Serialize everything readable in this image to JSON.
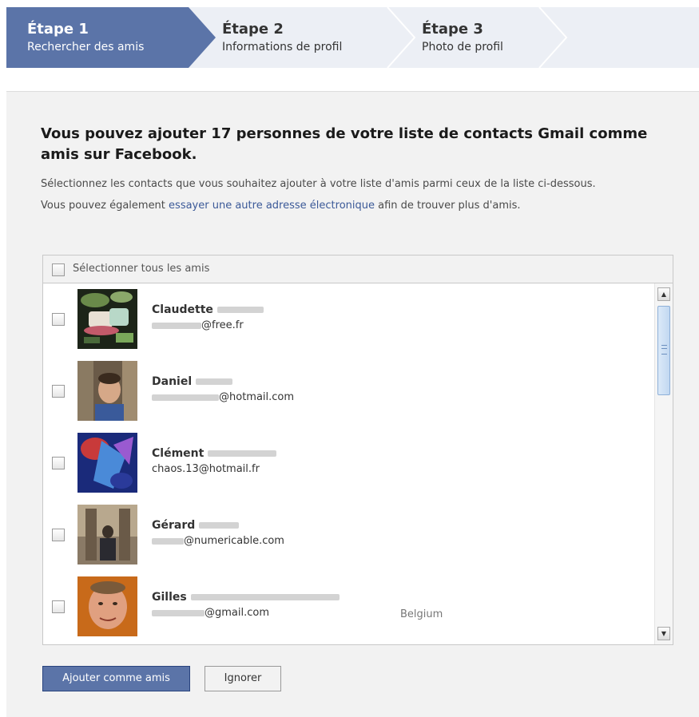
{
  "steps": [
    {
      "title": "Étape 1",
      "subtitle": "Rechercher des amis"
    },
    {
      "title": "Étape 2",
      "subtitle": "Informations de profil"
    },
    {
      "title": "Étape 3",
      "subtitle": "Photo de profil"
    }
  ],
  "main": {
    "heading": "Vous pouvez ajouter 17 personnes de votre liste de contacts Gmail comme amis sur Facebook.",
    "desc_part1": "Sélectionnez les contacts que vous souhaitez ajouter à votre liste d'amis parmi ceux de la liste ci-dessous. Vous pouvez également",
    "desc_link": "essayer une autre adresse électronique",
    "desc_part2": "afin de trouver plus d'amis."
  },
  "list": {
    "select_all_label": "Sélectionner tous les amis",
    "contacts": [
      {
        "name": "Claudette",
        "email": "@free.fr",
        "location": ""
      },
      {
        "name": "Daniel",
        "email": "@hotmail.com",
        "location": ""
      },
      {
        "name": "Clément",
        "email": "chaos.13@hotmail.fr",
        "location": ""
      },
      {
        "name": "Gérard",
        "email": "@numericable.com",
        "location": ""
      },
      {
        "name": "Gilles",
        "email": "@gmail.com",
        "location": "Belgium"
      }
    ]
  },
  "buttons": {
    "add_label": "Ajouter comme amis",
    "ignore_label": "Ignorer"
  },
  "colors": {
    "active_step": "#5b74a8",
    "link": "#3b5998",
    "steps_bg": "#eceff5",
    "panel_bg": "#f2f2f2"
  }
}
